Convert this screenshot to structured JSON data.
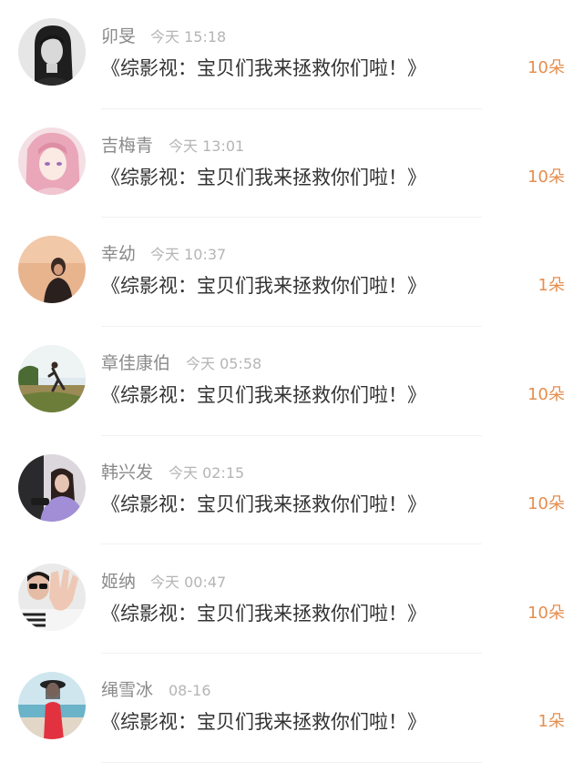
{
  "gift_list": {
    "items": [
      {
        "name": "卯旻",
        "time": "今天 15:18",
        "title": "《综影视：宝贝们我来拯救你们啦！》",
        "count": "10朵",
        "avatar_icon": "avatar-grayscale-portrait"
      },
      {
        "name": "吉梅青",
        "time": "今天 13:01",
        "title": "《综影视：宝贝们我来拯救你们啦！》",
        "count": "10朵",
        "avatar_icon": "avatar-anime-pink-hair"
      },
      {
        "name": "幸幼",
        "time": "今天 10:37",
        "title": "《综影视：宝贝们我来拯救你们啦！》",
        "count": "1朵",
        "avatar_icon": "avatar-person-warm-background"
      },
      {
        "name": "章佳康伯",
        "time": "今天 05:58",
        "title": "《综影视：宝贝们我来拯救你们啦！》",
        "count": "10朵",
        "avatar_icon": "avatar-runner-outdoors"
      },
      {
        "name": "韩兴发",
        "time": "今天 02:15",
        "title": "《综影视：宝贝们我来拯救你们啦！》",
        "count": "10朵",
        "avatar_icon": "avatar-girl-purple-shirt"
      },
      {
        "name": "姬纳",
        "time": "今天 00:47",
        "title": "《综影视：宝贝们我来拯救你们啦！》",
        "count": "10朵",
        "avatar_icon": "avatar-sunglasses-hand"
      },
      {
        "name": "绳雪冰",
        "time": "08-16",
        "title": "《综影视：宝贝们我来拯救你们啦！》",
        "count": "1朵",
        "avatar_icon": "avatar-girl-red-dress-beach"
      }
    ]
  },
  "colors": {
    "name": "#8a8a8a",
    "time": "#b5b5b5",
    "title": "#333333",
    "count_accent": "#e58e4e",
    "divider": "#f1f1f1"
  }
}
